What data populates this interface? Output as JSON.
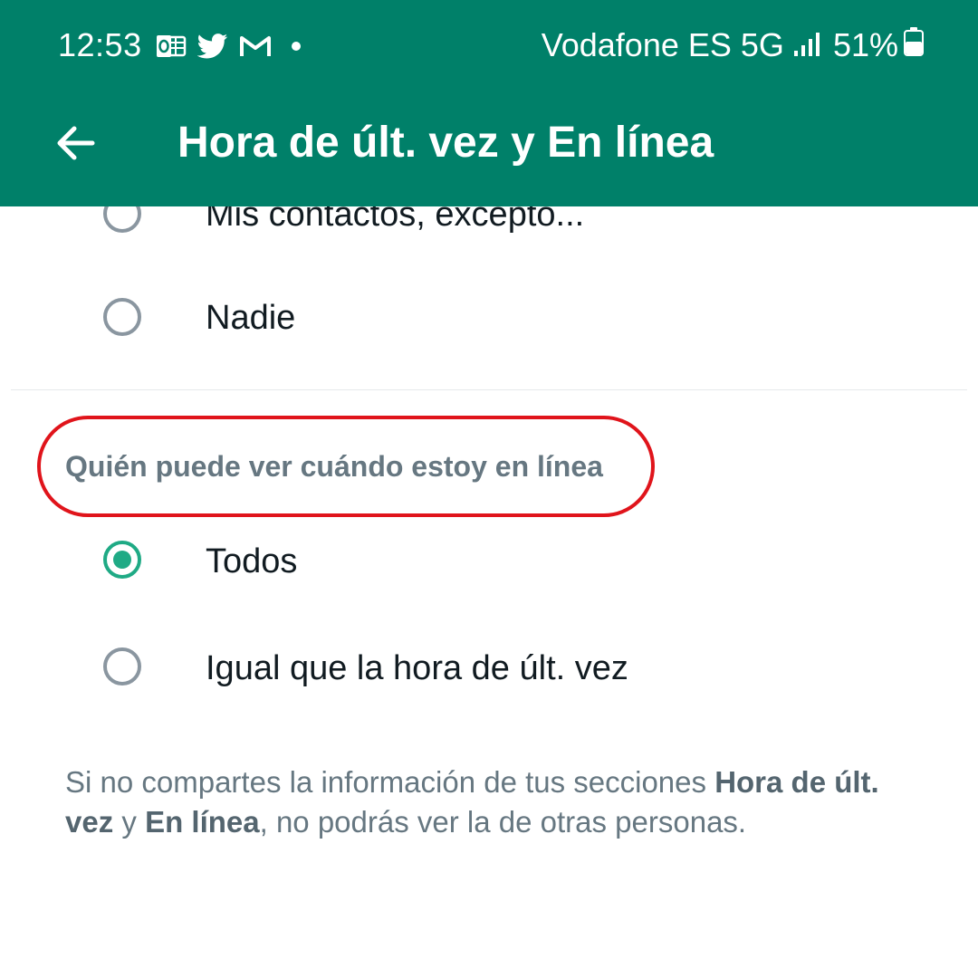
{
  "status_bar": {
    "time": "12:53",
    "notification_icons": [
      "outlook-icon",
      "twitter-icon",
      "gmail-icon",
      "dot-icon"
    ],
    "carrier": "Vodafone ES 5G",
    "battery": "51%"
  },
  "toolbar": {
    "title": "Hora de últ. vez y En línea",
    "back_icon": "arrow-left-icon"
  },
  "last_seen_options": [
    {
      "label": "Mis contactos, excepto...",
      "selected": false
    },
    {
      "label": "Nadie",
      "selected": false
    }
  ],
  "online_section": {
    "header": "Quién puede ver cuándo estoy en línea",
    "highlight_color": "#e0141b",
    "options": [
      {
        "label": "Todos",
        "selected": true
      },
      {
        "label": "Igual que la hora de últ. vez",
        "selected": false
      }
    ]
  },
  "footnote": {
    "part1": "Si no compartes la información de tus secciones ",
    "bold1": "Hora de últ. vez",
    "part2": " y ",
    "bold2": "En línea",
    "part3": ", no podrás ver la de otras personas."
  },
  "colors": {
    "app_bar": "#008069",
    "radio_checked": "#1faa85",
    "radio_unchecked": "#8a96a0"
  }
}
